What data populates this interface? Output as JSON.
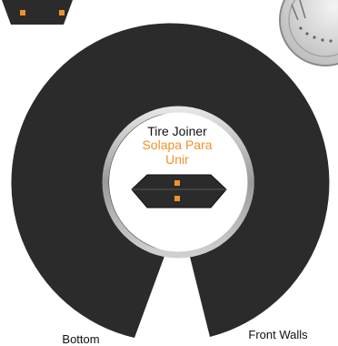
{
  "labels": {
    "tire_joiner": "Tire Joiner",
    "solapa_line1": "Solapa Para",
    "solapa_line2": "Unir",
    "bottom": "Bottom",
    "front_walls": "Front Walls"
  },
  "colors": {
    "piece_fill": "#2b2b2b",
    "accent_orange": "#f0922b",
    "inner_ring": "#b9b9b9",
    "label_dark": "#111111",
    "wheel_gray": "#d6d6d6"
  },
  "icons": {
    "wheel": "wheel-hub-icon"
  }
}
